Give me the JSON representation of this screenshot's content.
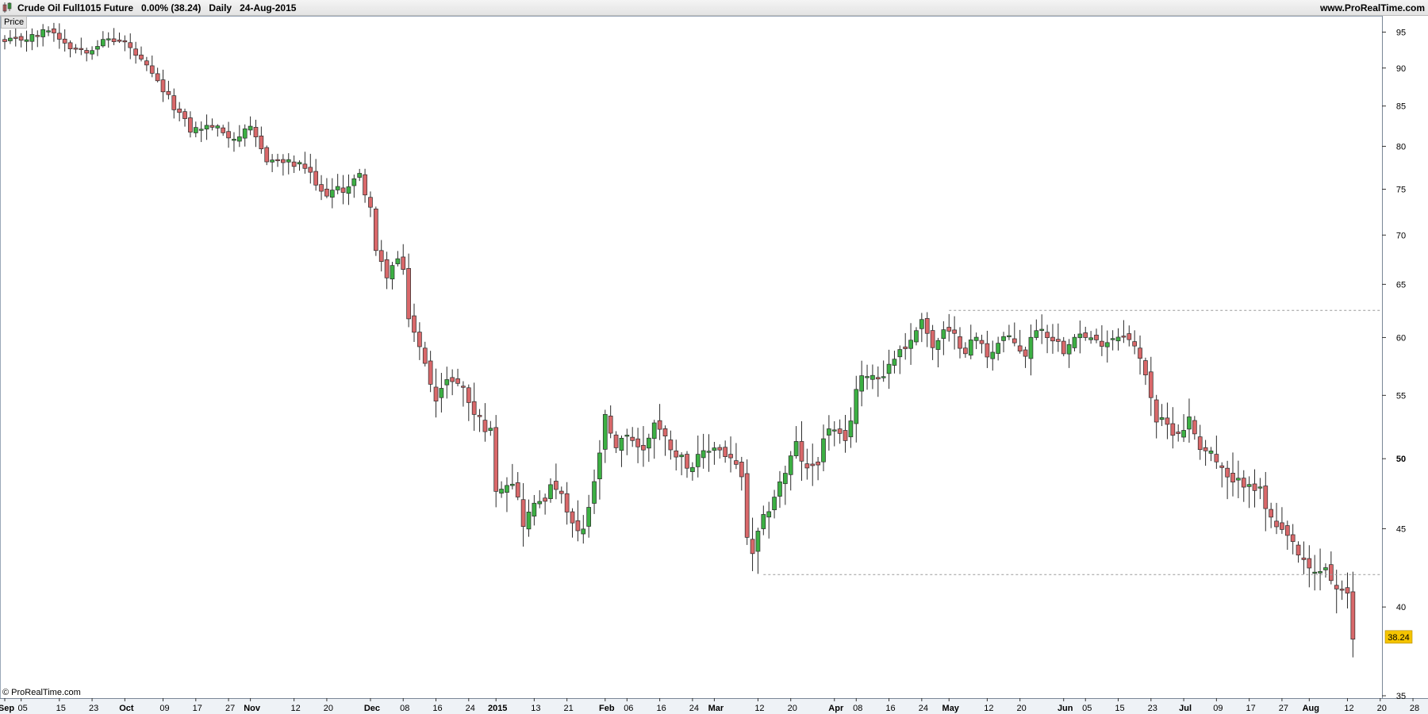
{
  "header": {
    "title": "Crude Oil Full1015 Future   0.00% (38.24)   Daily   24-Aug-2015",
    "website": "www.ProRealTime.com",
    "price_tab": "Price",
    "copyright": "© ProRealTime.com"
  },
  "colors": {
    "up": "#3cb043",
    "down": "#d9686a",
    "last_price_bg": "#f5c400",
    "dashed": "#9a9a9a"
  },
  "chart_data": {
    "type": "candlestick",
    "title": "Crude Oil Full1015 Future",
    "ylim": [
      35,
      97
    ],
    "y_ticks": [
      35,
      40,
      45,
      50,
      55,
      60,
      65,
      70,
      75,
      80,
      85,
      90,
      95
    ],
    "last_price": "38.24",
    "x_labels": [
      {
        "label": "Sep",
        "index": 0,
        "bold": true
      },
      {
        "label": "05",
        "index": 3
      },
      {
        "label": "15",
        "index": 10
      },
      {
        "label": "23",
        "index": 16
      },
      {
        "label": "Oct",
        "index": 22,
        "bold": true
      },
      {
        "label": "09",
        "index": 29
      },
      {
        "label": "17",
        "index": 35
      },
      {
        "label": "27",
        "index": 41
      },
      {
        "label": "Nov",
        "index": 45,
        "bold": true
      },
      {
        "label": "12",
        "index": 53
      },
      {
        "label": "20",
        "index": 59
      },
      {
        "label": "Dec",
        "index": 67,
        "bold": true
      },
      {
        "label": "08",
        "index": 73
      },
      {
        "label": "16",
        "index": 79
      },
      {
        "label": "24",
        "index": 85
      },
      {
        "label": "2015",
        "index": 90,
        "bold": true
      },
      {
        "label": "13",
        "index": 97
      },
      {
        "label": "21",
        "index": 103
      },
      {
        "label": "Feb",
        "index": 110,
        "bold": true
      },
      {
        "label": "06",
        "index": 114
      },
      {
        "label": "16",
        "index": 120
      },
      {
        "label": "24",
        "index": 126
      },
      {
        "label": "Mar",
        "index": 130,
        "bold": true
      },
      {
        "label": "12",
        "index": 138
      },
      {
        "label": "20",
        "index": 144
      },
      {
        "label": "Apr",
        "index": 152,
        "bold": true
      },
      {
        "label": "08",
        "index": 156
      },
      {
        "label": "16",
        "index": 162
      },
      {
        "label": "24",
        "index": 168
      },
      {
        "label": "May",
        "index": 173,
        "bold": true
      },
      {
        "label": "12",
        "index": 180
      },
      {
        "label": "20",
        "index": 186
      },
      {
        "label": "Jun",
        "index": 194,
        "bold": true
      },
      {
        "label": "05",
        "index": 198
      },
      {
        "label": "15",
        "index": 204
      },
      {
        "label": "23",
        "index": 210
      },
      {
        "label": "Jul",
        "index": 216,
        "bold": true
      },
      {
        "label": "09",
        "index": 222
      },
      {
        "label": "17",
        "index": 228
      },
      {
        "label": "27",
        "index": 234
      },
      {
        "label": "Aug",
        "index": 239,
        "bold": true
      },
      {
        "label": "12",
        "index": 246
      },
      {
        "label": "20",
        "index": 252
      },
      {
        "label": "28",
        "index": 258
      }
    ],
    "x_slots": 260,
    "anchors": [
      [
        0,
        93.5
      ],
      [
        6,
        94.5
      ],
      [
        8,
        95.5
      ],
      [
        12,
        93.0
      ],
      [
        15,
        92.5
      ],
      [
        19,
        94.0
      ],
      [
        22,
        93.5
      ],
      [
        26,
        90.0
      ],
      [
        30,
        86.0
      ],
      [
        34,
        82.0
      ],
      [
        38,
        82.5
      ],
      [
        42,
        81.0
      ],
      [
        45,
        82.0
      ],
      [
        48,
        78.5
      ],
      [
        52,
        78.0
      ],
      [
        55,
        77.5
      ],
      [
        58,
        74.5
      ],
      [
        62,
        75.0
      ],
      [
        65,
        76.5
      ],
      [
        67,
        73.0
      ],
      [
        68,
        68.0
      ],
      [
        70,
        66.0
      ],
      [
        72,
        67.5
      ],
      [
        73,
        66.0
      ],
      [
        74,
        62.0
      ],
      [
        77,
        57.5
      ],
      [
        79,
        55.0
      ],
      [
        82,
        56.5
      ],
      [
        84,
        55.5
      ],
      [
        86,
        53.5
      ],
      [
        89,
        52.0
      ],
      [
        90,
        48.0
      ],
      [
        93,
        48.5
      ],
      [
        95,
        45.5
      ],
      [
        98,
        47.0
      ],
      [
        101,
        48.0
      ],
      [
        103,
        46.0
      ],
      [
        105,
        44.5
      ],
      [
        106,
        45.0
      ],
      [
        108,
        48.0
      ],
      [
        110,
        53.0
      ],
      [
        112,
        50.5
      ],
      [
        114,
        52.0
      ],
      [
        117,
        50.5
      ],
      [
        119,
        53.0
      ],
      [
        121,
        51.5
      ],
      [
        124,
        50.0
      ],
      [
        126,
        49.5
      ],
      [
        130,
        51.0
      ],
      [
        133,
        50.0
      ],
      [
        135,
        48.5
      ],
      [
        136,
        44.5
      ],
      [
        137,
        43.0
      ],
      [
        138,
        44.5
      ],
      [
        140,
        46.5
      ],
      [
        143,
        49.0
      ],
      [
        145,
        51.0
      ],
      [
        147,
        49.0
      ],
      [
        149,
        50.0
      ],
      [
        151,
        52.5
      ],
      [
        154,
        51.0
      ],
      [
        156,
        55.5
      ],
      [
        158,
        57.0
      ],
      [
        160,
        56.5
      ],
      [
        162,
        57.5
      ],
      [
        164,
        59.0
      ],
      [
        166,
        59.5
      ],
      [
        168,
        62.0
      ],
      [
        170,
        59.0
      ],
      [
        172,
        60.5
      ],
      [
        174,
        60.0
      ],
      [
        176,
        59.0
      ],
      [
        178,
        60.0
      ],
      [
        180,
        58.5
      ],
      [
        183,
        60.0
      ],
      [
        185,
        59.5
      ],
      [
        187,
        58.5
      ],
      [
        189,
        61.0
      ],
      [
        192,
        60.0
      ],
      [
        194,
        59.0
      ],
      [
        196,
        60.5
      ],
      [
        198,
        60.0
      ],
      [
        200,
        59.5
      ],
      [
        203,
        60.0
      ],
      [
        205,
        60.5
      ],
      [
        207,
        59.0
      ],
      [
        209,
        57.0
      ],
      [
        211,
        53.0
      ],
      [
        213,
        52.5
      ],
      [
        215,
        52.0
      ],
      [
        217,
        53.0
      ],
      [
        219,
        51.0
      ],
      [
        221,
        50.5
      ],
      [
        223,
        49.0
      ],
      [
        225,
        48.0
      ],
      [
        228,
        48.5
      ],
      [
        230,
        47.5
      ],
      [
        232,
        45.5
      ],
      [
        234,
        44.5
      ],
      [
        236,
        44.0
      ],
      [
        238,
        42.5
      ],
      [
        240,
        42.0
      ],
      [
        242,
        42.5
      ],
      [
        244,
        41.0
      ],
      [
        246,
        40.5
      ],
      [
        247,
        38.2
      ]
    ],
    "resistance": {
      "price": 62.5,
      "from_index": 173
    },
    "support": {
      "price": 42.0,
      "from_index": 139
    }
  }
}
